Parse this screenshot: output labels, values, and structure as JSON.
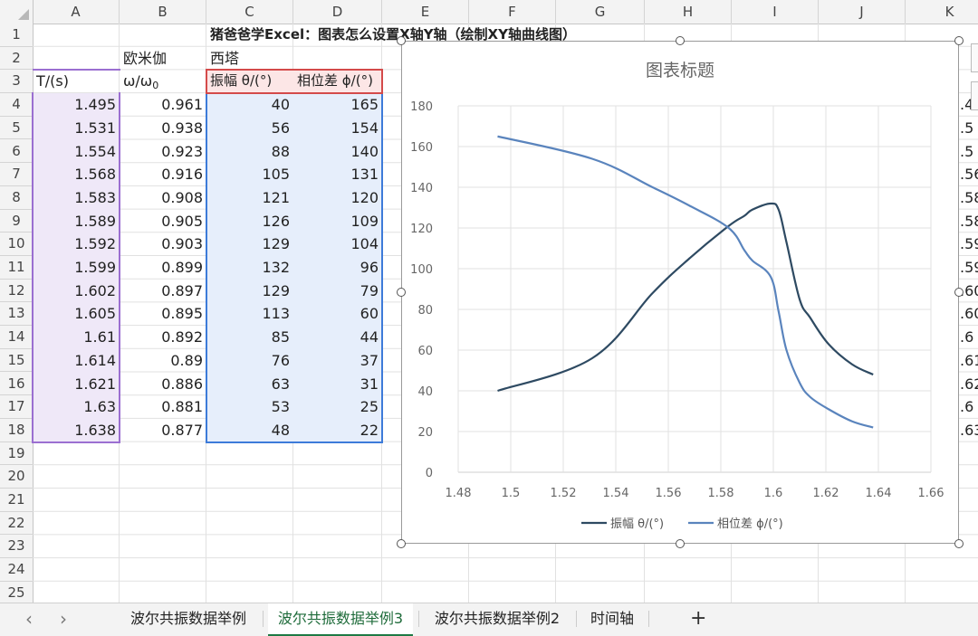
{
  "columns": [
    "A",
    "B",
    "C",
    "D",
    "E",
    "F",
    "G",
    "H",
    "I",
    "J",
    "K"
  ],
  "rows": [
    "1",
    "2",
    "3",
    "4",
    "5",
    "6",
    "7",
    "8",
    "9",
    "10",
    "11",
    "12",
    "13",
    "14",
    "15",
    "16",
    "17",
    "18",
    "19",
    "20",
    "21",
    "22",
    "23",
    "24",
    "25"
  ],
  "title_text": "猪爸爸学Excel：图表怎么设置X轴Y轴（绘制XY轴曲线图）",
  "b2": "欧米伽",
  "c2": "西塔",
  "headers": {
    "a3": "T/(s)",
    "b3_main": "ω/ω",
    "b3_sub": "0",
    "c3": "振幅 θ/(°)",
    "d3": "相位差 ϕ/(°)"
  },
  "table": [
    [
      "1.495",
      "0.961",
      "40",
      "165"
    ],
    [
      "1.531",
      "0.938",
      "56",
      "154"
    ],
    [
      "1.554",
      "0.923",
      "88",
      "140"
    ],
    [
      "1.568",
      "0.916",
      "105",
      "131"
    ],
    [
      "1.583",
      "0.908",
      "121",
      "120"
    ],
    [
      "1.589",
      "0.905",
      "126",
      "109"
    ],
    [
      "1.592",
      "0.903",
      "129",
      "104"
    ],
    [
      "1.599",
      "0.899",
      "132",
      "96"
    ],
    [
      "1.602",
      "0.897",
      "129",
      "79"
    ],
    [
      "1.605",
      "0.895",
      "113",
      "60"
    ],
    [
      "1.61",
      "0.892",
      "85",
      "44"
    ],
    [
      "1.614",
      "0.89",
      "76",
      "37"
    ],
    [
      "1.621",
      "0.886",
      "63",
      "31"
    ],
    [
      "1.63",
      "0.881",
      "53",
      "25"
    ],
    [
      "1.638",
      "0.877",
      "48",
      "22"
    ]
  ],
  "k_partial": [
    ".4",
    ".5",
    ".5",
    ".56",
    ".58",
    ".58",
    ".59",
    ".59",
    ".60",
    ".60",
    ".6",
    ".61",
    ".62",
    ".6",
    ".63"
  ],
  "chart_data": {
    "type": "scatter",
    "title": "图表标题",
    "x": [
      1.495,
      1.531,
      1.554,
      1.568,
      1.583,
      1.589,
      1.592,
      1.599,
      1.602,
      1.605,
      1.61,
      1.614,
      1.621,
      1.63,
      1.638
    ],
    "series": [
      {
        "name": "振幅 θ/(°)",
        "values": [
          40,
          56,
          88,
          105,
          121,
          126,
          129,
          132,
          129,
          113,
          85,
          76,
          63,
          53,
          48
        ],
        "color": "#2e4a62"
      },
      {
        "name": "相位差 ϕ/(°)",
        "values": [
          165,
          154,
          140,
          131,
          120,
          109,
          104,
          96,
          79,
          60,
          44,
          37,
          31,
          25,
          22
        ],
        "color": "#5a84bd"
      }
    ],
    "xlim": [
      1.48,
      1.66
    ],
    "ylim": [
      0,
      180
    ],
    "xticks": [
      "1.48",
      "1.5",
      "1.52",
      "1.54",
      "1.56",
      "1.58",
      "1.6",
      "1.62",
      "1.64",
      "1.66"
    ],
    "yticks": [
      "0",
      "20",
      "40",
      "60",
      "80",
      "100",
      "120",
      "140",
      "160",
      "180"
    ],
    "grid": true,
    "legend": "bottom",
    "smooth": true
  },
  "tabs": [
    "波尔共振数据举例",
    "波尔共振数据举例3",
    "波尔共振数据举例2",
    "时间轴"
  ],
  "active_tab": 1,
  "nav": {
    "prev": "‹",
    "next": "›",
    "add": "+"
  }
}
